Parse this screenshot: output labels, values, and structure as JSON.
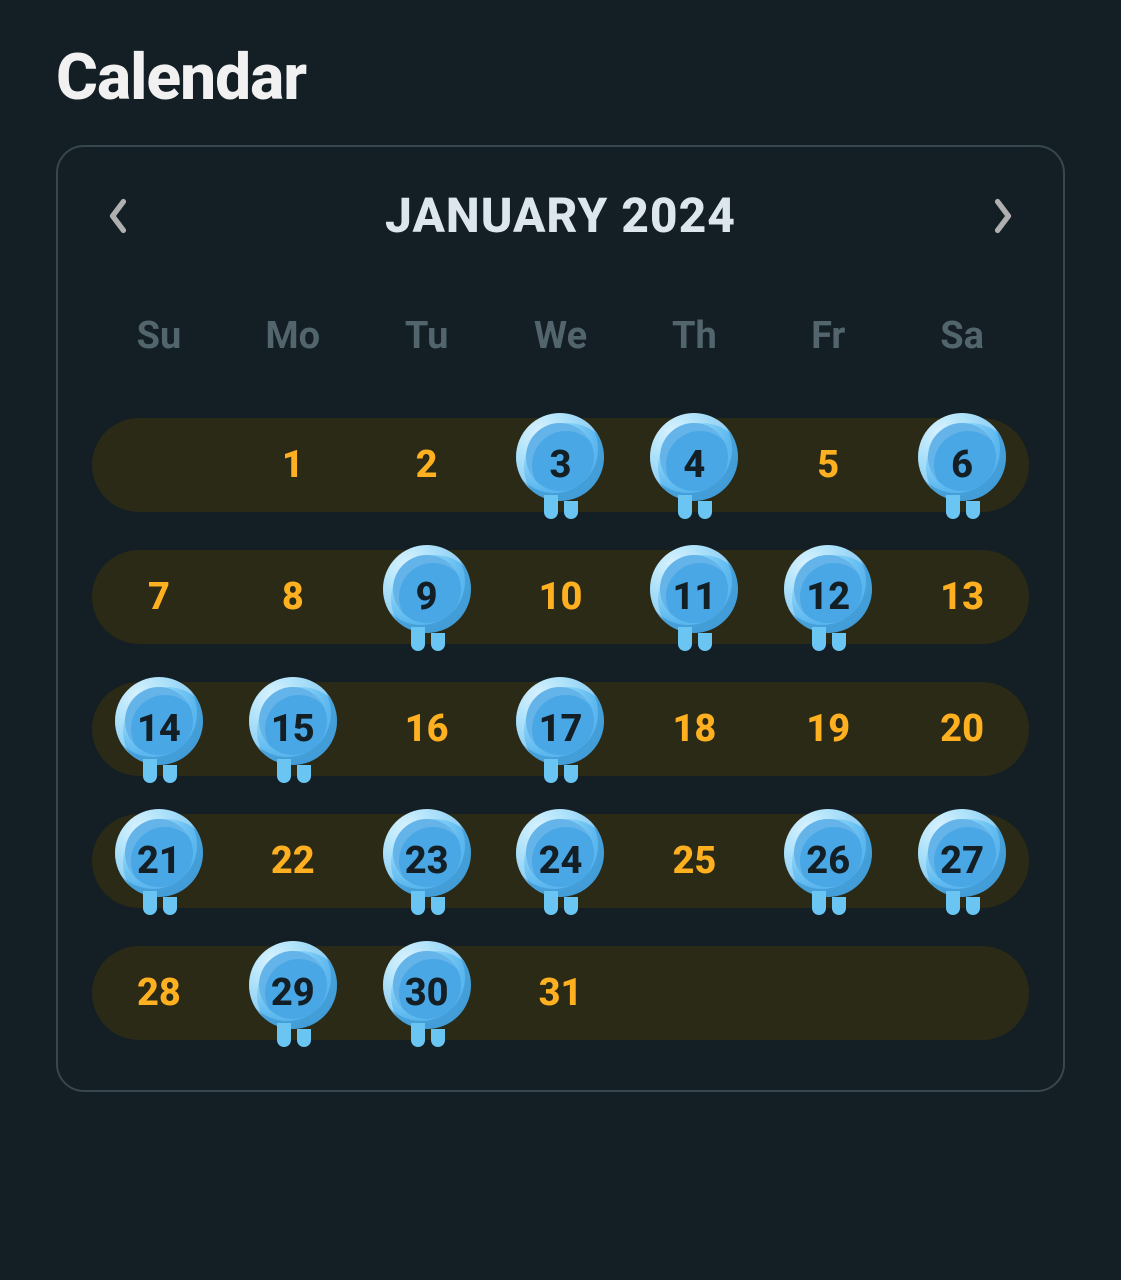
{
  "title": "Calendar",
  "month_label": "JANUARY 2024",
  "weekdays": [
    "Su",
    "Mo",
    "Tu",
    "We",
    "Th",
    "Fr",
    "Sa"
  ],
  "weeks": [
    {
      "bar": {
        "start": 0,
        "end": 6
      },
      "days": [
        {
          "n": "",
          "style": "empty",
          "freeze": false
        },
        {
          "n": "1",
          "style": "orange",
          "freeze": false
        },
        {
          "n": "2",
          "style": "orange",
          "freeze": false
        },
        {
          "n": "3",
          "style": "dark",
          "freeze": true
        },
        {
          "n": "4",
          "style": "dark",
          "freeze": true
        },
        {
          "n": "5",
          "style": "orange",
          "freeze": false
        },
        {
          "n": "6",
          "style": "dark",
          "freeze": true
        }
      ]
    },
    {
      "bar": {
        "start": 0,
        "end": 6
      },
      "days": [
        {
          "n": "7",
          "style": "orange",
          "freeze": false
        },
        {
          "n": "8",
          "style": "orange",
          "freeze": false
        },
        {
          "n": "9",
          "style": "dark",
          "freeze": true
        },
        {
          "n": "10",
          "style": "orange",
          "freeze": false
        },
        {
          "n": "11",
          "style": "dark",
          "freeze": true
        },
        {
          "n": "12",
          "style": "dark",
          "freeze": true
        },
        {
          "n": "13",
          "style": "orange",
          "freeze": false
        }
      ]
    },
    {
      "bar": {
        "start": 0,
        "end": 6
      },
      "days": [
        {
          "n": "14",
          "style": "dark",
          "freeze": true
        },
        {
          "n": "15",
          "style": "dark",
          "freeze": true
        },
        {
          "n": "16",
          "style": "orange",
          "freeze": false
        },
        {
          "n": "17",
          "style": "dark",
          "freeze": true
        },
        {
          "n": "18",
          "style": "orange",
          "freeze": false
        },
        {
          "n": "19",
          "style": "orange",
          "freeze": false
        },
        {
          "n": "20",
          "style": "orange",
          "freeze": false
        }
      ]
    },
    {
      "bar": {
        "start": 0,
        "end": 6
      },
      "days": [
        {
          "n": "21",
          "style": "dark",
          "freeze": true
        },
        {
          "n": "22",
          "style": "orange",
          "freeze": false
        },
        {
          "n": "23",
          "style": "dark",
          "freeze": true
        },
        {
          "n": "24",
          "style": "dark",
          "freeze": true
        },
        {
          "n": "25",
          "style": "orange",
          "freeze": false
        },
        {
          "n": "26",
          "style": "dark",
          "freeze": true
        },
        {
          "n": "27",
          "style": "dark",
          "freeze": true
        }
      ]
    },
    {
      "bar": {
        "start": 0,
        "end": 6
      },
      "days": [
        {
          "n": "28",
          "style": "orange",
          "freeze": false
        },
        {
          "n": "29",
          "style": "dark",
          "freeze": true
        },
        {
          "n": "30",
          "style": "dark",
          "freeze": true
        },
        {
          "n": "31",
          "style": "orange",
          "freeze": false
        },
        {
          "n": "",
          "style": "empty",
          "freeze": false
        },
        {
          "n": "",
          "style": "empty",
          "freeze": false
        },
        {
          "n": "",
          "style": "empty",
          "freeze": false
        }
      ]
    }
  ],
  "colors": {
    "bg": "#131f24",
    "card_border": "#37464f",
    "streak_bar": "#2a2a16",
    "day_orange": "#ffb020",
    "freeze_light": "#90d8f9",
    "freeze_dark": "#49a7e6"
  }
}
